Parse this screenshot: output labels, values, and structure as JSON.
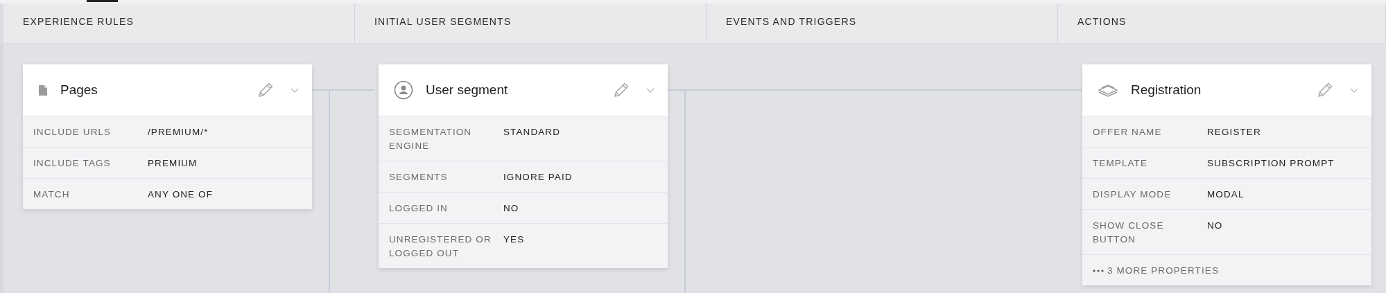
{
  "columns": [
    {
      "title": "EXPERIENCE RULES",
      "cards": [
        {
          "kind": "pages",
          "title": "Pages",
          "rows": [
            {
              "label": "INCLUDE URLS",
              "value": "/PREMIUM/*"
            },
            {
              "label": "INCLUDE TAGS",
              "value": "PREMIUM"
            },
            {
              "label": "MATCH",
              "value": "ANY ONE OF"
            }
          ]
        }
      ]
    },
    {
      "title": "INITIAL USER SEGMENTS",
      "cards": [
        {
          "kind": "segment",
          "title": "User segment",
          "rows": [
            {
              "label": "SEGMENTATION ENGINE",
              "value": "STANDARD"
            },
            {
              "label": "SEGMENTS",
              "value": "IGNORE PAID"
            },
            {
              "label": "LOGGED IN",
              "value": "NO"
            },
            {
              "label": "UNREGISTERED OR LOGGED OUT",
              "value": "YES"
            }
          ]
        }
      ]
    },
    {
      "title": "EVENTS AND TRIGGERS"
    },
    {
      "title": "ACTIONS",
      "cards": [
        {
          "kind": "offer",
          "title": "Registration",
          "rows": [
            {
              "label": "OFFER NAME",
              "value": "REGISTER"
            },
            {
              "label": "TEMPLATE",
              "value": "SUBSCRIPTION PROMPT"
            },
            {
              "label": "DISPLAY MODE",
              "value": "MODAL"
            },
            {
              "label": "SHOW CLOSE BUTTON",
              "value": "NO"
            }
          ],
          "more": "3 MORE PROPERTIES"
        }
      ]
    }
  ]
}
